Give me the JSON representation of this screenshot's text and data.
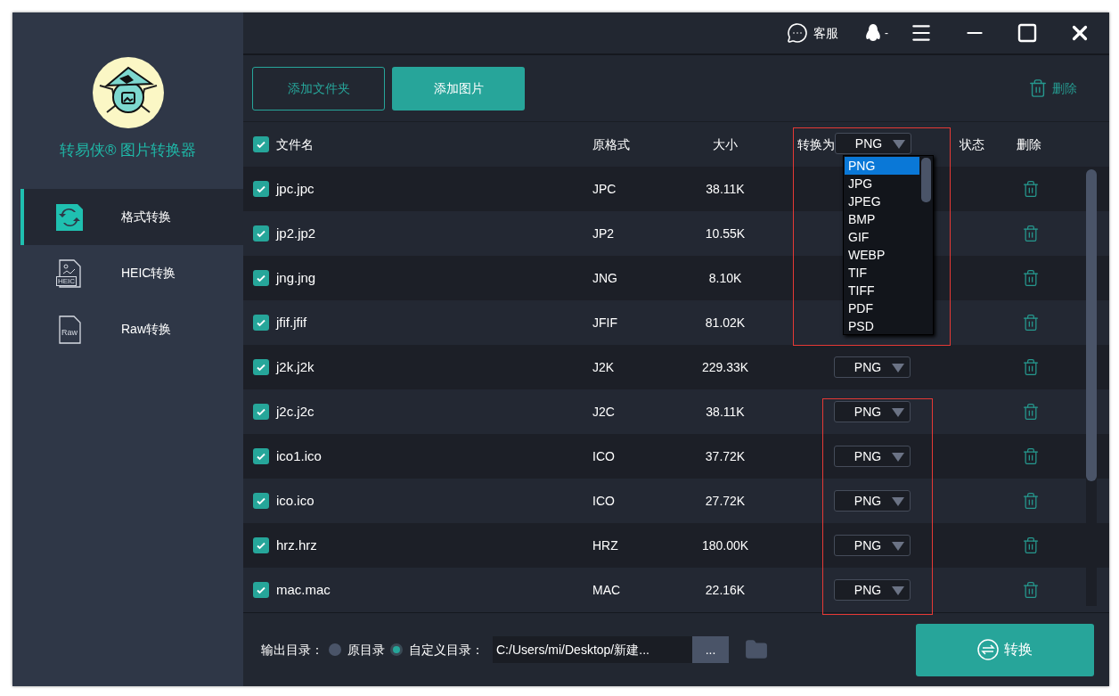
{
  "topbar": {
    "service": "客服",
    "account": "-"
  },
  "sidebar": {
    "brand": "转易侠® 图片转换器",
    "items": [
      {
        "kind": "convert",
        "label": "格式转换",
        "selected": true
      },
      {
        "kind": "heic",
        "badge": "HEIC",
        "label": "HEIC转换",
        "selected": false
      },
      {
        "kind": "raw",
        "badge": "Raw",
        "label": "Raw转换",
        "selected": false
      }
    ]
  },
  "toolbar": {
    "buttons": [
      {
        "label": "添加文件夹",
        "kind": "outline"
      },
      {
        "label": "添加图片",
        "kind": "filled"
      }
    ],
    "delete": "删除"
  },
  "table": {
    "all_checked": true,
    "columns": [
      "文件名",
      "原格式",
      "大小",
      "转换为",
      "状态",
      "删除"
    ],
    "target": "PNG",
    "rows": [
      {
        "name": "jpc.jpc",
        "format": "JPC",
        "size": "38.11K",
        "checked": true
      },
      {
        "name": "jp2.jp2",
        "format": "JP2",
        "size": "10.55K",
        "checked": true
      },
      {
        "name": "jng.jng",
        "format": "JNG",
        "size": "8.10K",
        "checked": true
      },
      {
        "name": "jfif.jfif",
        "format": "JFIF",
        "size": "81.02K",
        "checked": true
      },
      {
        "name": "j2k.j2k",
        "format": "J2K",
        "size": "229.33K",
        "checked": true,
        "target": "PNG"
      },
      {
        "name": "j2c.j2c",
        "format": "J2C",
        "size": "38.11K",
        "checked": true,
        "target": "PNG"
      },
      {
        "name": "ico1.ico",
        "format": "ICO",
        "size": "37.72K",
        "checked": true,
        "target": "PNG"
      },
      {
        "name": "ico.ico",
        "format": "ICO",
        "size": "27.72K",
        "checked": true,
        "target": "PNG"
      },
      {
        "name": "hrz.hrz",
        "format": "HRZ",
        "size": "180.00K",
        "checked": true,
        "target": "PNG"
      },
      {
        "name": "mac.mac",
        "format": "MAC",
        "size": "22.16K",
        "checked": true,
        "target": "PNG"
      }
    ]
  },
  "dropdown": {
    "options": [
      {
        "label": "PNG",
        "selected": true
      },
      {
        "label": "JPG",
        "selected": false
      },
      {
        "label": "JPEG",
        "selected": false
      },
      {
        "label": "BMP",
        "selected": false
      },
      {
        "label": "GIF",
        "selected": false
      },
      {
        "label": "WEBP",
        "selected": false
      },
      {
        "label": "TIF",
        "selected": false
      },
      {
        "label": "TIFF",
        "selected": false
      },
      {
        "label": "PDF",
        "selected": false
      },
      {
        "label": "PSD",
        "selected": false
      }
    ]
  },
  "output": {
    "label": "输出目录：",
    "options": [
      {
        "label": "原目录",
        "selected": false
      },
      {
        "label": "自定义目录：",
        "selected": true
      }
    ],
    "path": "C:/Users/mi/Desktop/新建...",
    "browse": "..."
  },
  "convert": "转换"
}
